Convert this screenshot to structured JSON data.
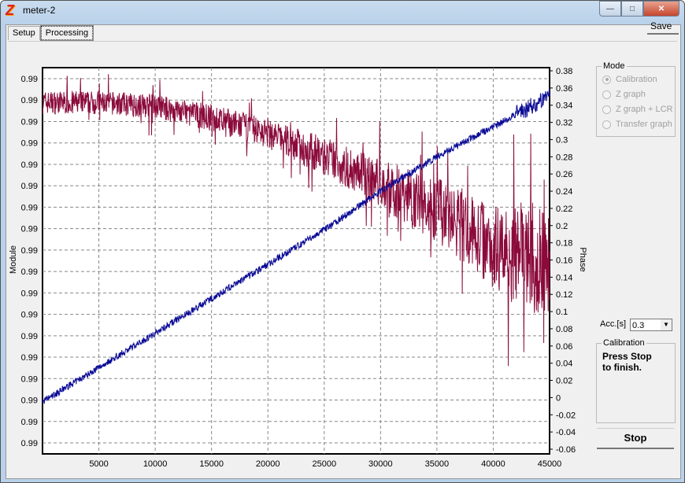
{
  "window": {
    "title": "meter-2",
    "controls": [
      "minimize",
      "maximize",
      "close"
    ]
  },
  "tabs": [
    {
      "label": "Setup",
      "active": false
    },
    {
      "label": "Processing",
      "active": true
    }
  ],
  "toolbar": {
    "save_label": "Save"
  },
  "mode": {
    "legend": "Mode",
    "options": [
      {
        "label": "Calibration",
        "selected": true,
        "enabled": false
      },
      {
        "label": "Z graph",
        "selected": false,
        "enabled": false
      },
      {
        "label": "Z graph + LCR",
        "selected": false,
        "enabled": false
      },
      {
        "label": "Transfer graph",
        "selected": false,
        "enabled": false
      }
    ]
  },
  "acc": {
    "label": "Acc.[s]",
    "value": "0.3"
  },
  "calibration": {
    "legend": "Calibration",
    "message_line1": "Press Stop",
    "message_line2": "to finish."
  },
  "stop_label": "Stop",
  "chart_data": {
    "type": "line",
    "xlabel": "",
    "ylabel_left": "Module",
    "ylabel_right": "Phase",
    "xlim": [
      0,
      45000
    ],
    "x_ticks": [
      "5000",
      "10000",
      "15000",
      "20000",
      "25000",
      "30000",
      "35000",
      "40000",
      "45000"
    ],
    "y_left_ticks": [
      "0.99",
      "0.99",
      "0.99",
      "0.99",
      "0.99",
      "0.99",
      "0.99",
      "0.99",
      "0.99",
      "0.99",
      "0.99",
      "0.99",
      "0.99",
      "0.99",
      "0.99",
      "0.99",
      "0.99",
      "0.99"
    ],
    "y_right_ticks": [
      "0.38",
      "0.36",
      "0.34",
      "0.32",
      "0.3",
      "0.28",
      "0.26",
      "0.24",
      "0.22",
      "0.2",
      "0.18",
      "0.16",
      "0.14",
      "0.12",
      "0.1",
      "0.08",
      "0.06",
      "0.04",
      "0.02",
      "0",
      "-0.02",
      "-0.04",
      "-0.06"
    ],
    "ylim_right": [
      -0.06,
      0.38
    ],
    "grid": true,
    "colors": {
      "module": "#8b0a3a",
      "phase": "#0a0a96",
      "module_label": "#d00000",
      "phase_label": "#4040ff"
    },
    "series": [
      {
        "name": "Module",
        "axis": "left",
        "x": [
          0,
          5000,
          10000,
          15000,
          20000,
          25000,
          30000,
          35000,
          40000,
          45000
        ],
        "y_normalized": [
          0.91,
          0.91,
          0.9,
          0.87,
          0.83,
          0.77,
          0.7,
          0.63,
          0.54,
          0.5
        ],
        "noise": "increasing"
      },
      {
        "name": "Phase",
        "axis": "right",
        "x": [
          0,
          5000,
          10000,
          15000,
          20000,
          25000,
          30000,
          35000,
          40000,
          45000
        ],
        "y": [
          -0.005,
          0.035,
          0.075,
          0.115,
          0.155,
          0.195,
          0.24,
          0.28,
          0.315,
          0.35
        ]
      }
    ]
  }
}
